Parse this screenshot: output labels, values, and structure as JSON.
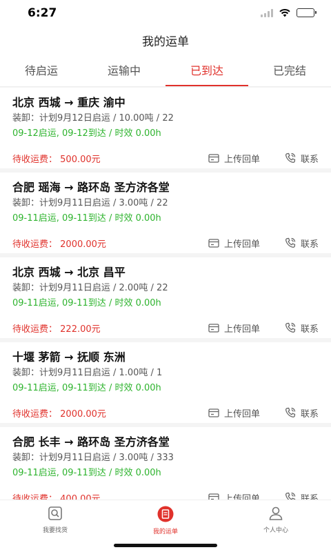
{
  "status_bar": {
    "time": "6:27"
  },
  "header": {
    "title": "我的运单"
  },
  "tabs": [
    {
      "label": "待启运",
      "active": false
    },
    {
      "label": "运输中",
      "active": false
    },
    {
      "label": "已到达",
      "active": true
    },
    {
      "label": "已完结",
      "active": false
    }
  ],
  "orders": [
    {
      "route": "北京 西城 → 重庆 渝中",
      "detail": "装卸：计划9月12日启运 / 10.00吨 / 22",
      "timing": "09-12启运, 09-12到达 / 时效 0.00h",
      "freight_label": "待收运费：",
      "freight_value": "500.00元",
      "upload_label": "上传回单",
      "contact_label": "联系"
    },
    {
      "route": "合肥 瑶海 → 路环岛 圣方济各堂",
      "detail": "装卸：计划9月11日启运 / 3.00吨 / 22",
      "timing": "09-11启运, 09-11到达 / 时效 0.00h",
      "freight_label": "待收运费：",
      "freight_value": "2000.00元",
      "upload_label": "上传回单",
      "contact_label": "联系"
    },
    {
      "route": "北京 西城 → 北京 昌平",
      "detail": "装卸：计划9月11日启运 / 2.00吨 / 22",
      "timing": "09-11启运, 09-11到达 / 时效 0.00h",
      "freight_label": "待收运费：",
      "freight_value": "222.00元",
      "upload_label": "上传回单",
      "contact_label": "联系"
    },
    {
      "route": "十堰 茅箭 → 抚顺 东洲",
      "detail": "装卸：计划9月11日启运 / 1.00吨 / 1",
      "timing": "09-11启运, 09-11到达 / 时效 0.00h",
      "freight_label": "待收运费：",
      "freight_value": "2000.00元",
      "upload_label": "上传回单",
      "contact_label": "联系"
    },
    {
      "route": "合肥 长丰 → 路环岛 圣方济各堂",
      "detail": "装卸：计划9月11日启运 / 3.00吨 / 333",
      "timing": "09-11启运, 09-11到达 / 时效 0.00h",
      "freight_label": "待收运费：",
      "freight_value": "400.00元",
      "upload_label": "上传回单",
      "contact_label": "联系"
    }
  ],
  "bottom_nav": [
    {
      "label": "我要找货",
      "icon": "search-goods-icon",
      "active": false
    },
    {
      "label": "我的运单",
      "icon": "waybill-icon",
      "active": true
    },
    {
      "label": "个人中心",
      "icon": "profile-icon",
      "active": false
    }
  ],
  "colors": {
    "accent": "#e0312b",
    "success": "#2db32d",
    "background": "#f4f4f4"
  }
}
